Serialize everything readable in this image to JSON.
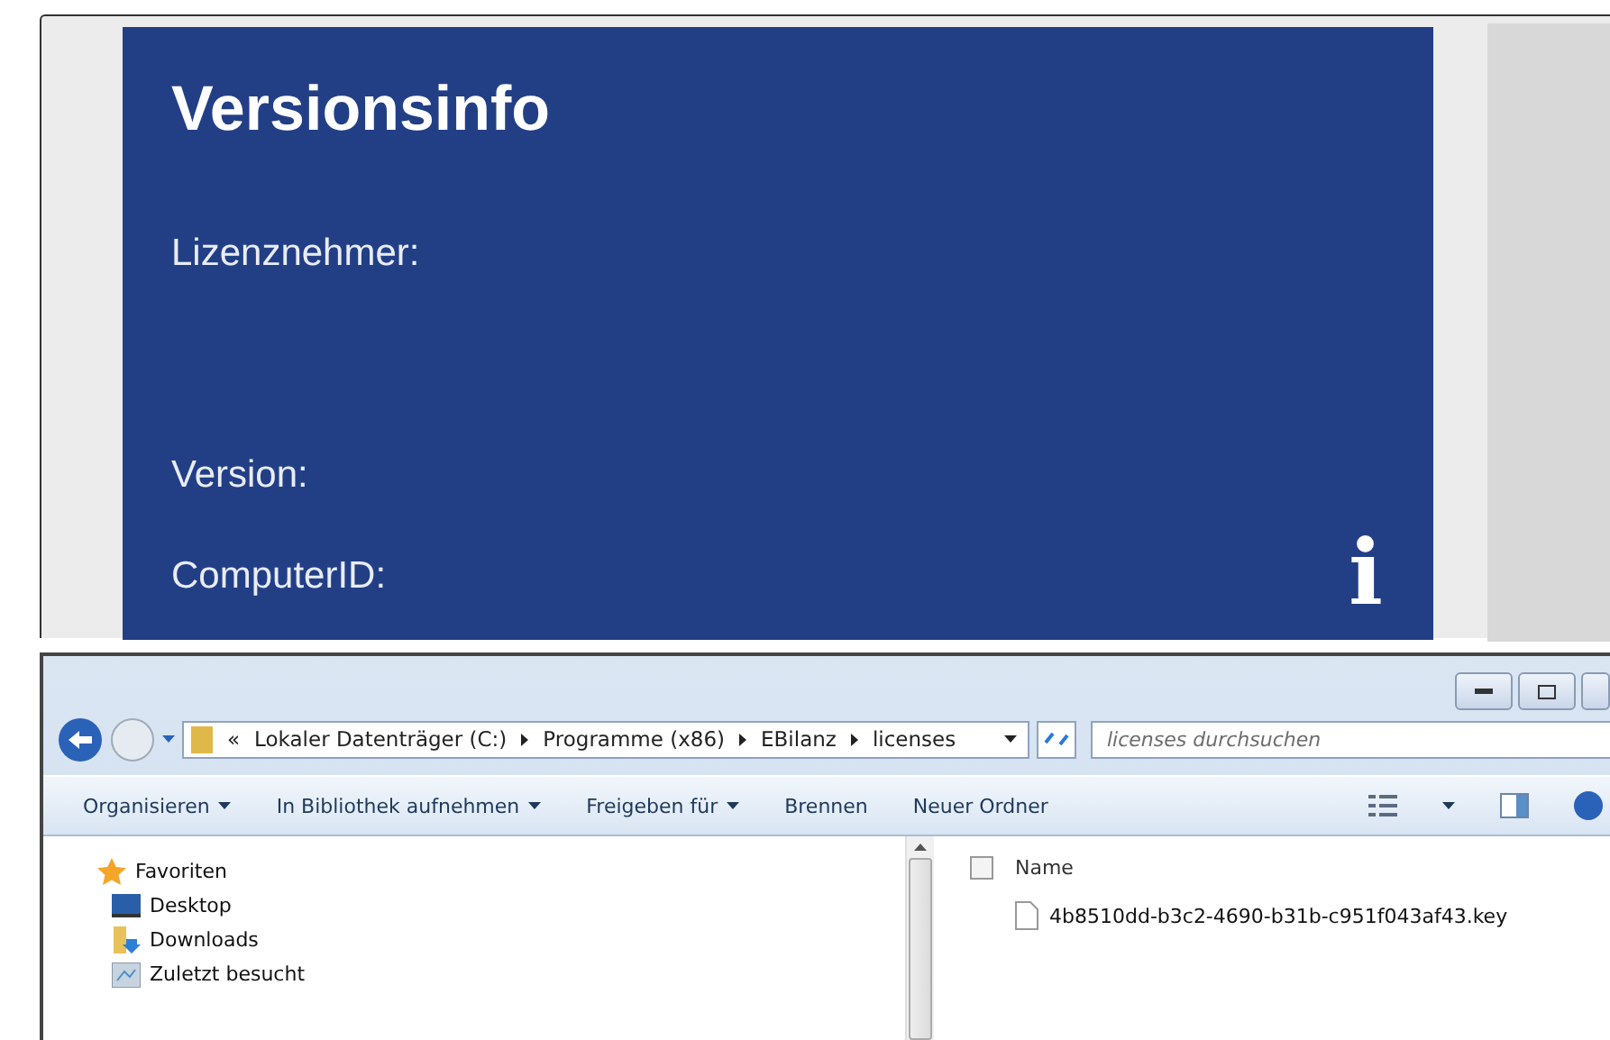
{
  "version_dialog": {
    "title": "Versionsinfo",
    "fields": [
      "Lizenznehmer:",
      "Version:",
      "ComputerID:"
    ],
    "info_glyph": "i"
  },
  "explorer": {
    "overflow_mark": "«",
    "breadcrumb": [
      "Lokaler Datenträger (C:)",
      "Programme (x86)",
      "EBilanz",
      "licenses"
    ],
    "search": {
      "placeholder": "licenses durchsuchen"
    },
    "toolbar": [
      {
        "label": "Organisieren",
        "dropdown": true
      },
      {
        "label": "In Bibliothek aufnehmen",
        "dropdown": true
      },
      {
        "label": "Freigeben für",
        "dropdown": true
      },
      {
        "label": "Brennen",
        "dropdown": false
      },
      {
        "label": "Neuer Ordner",
        "dropdown": false
      }
    ],
    "nav": [
      {
        "label": "Favoriten",
        "kind": "star",
        "children": [
          {
            "label": "Desktop",
            "kind": "desktop"
          },
          {
            "label": "Downloads",
            "kind": "downloads"
          },
          {
            "label": "Zuletzt besucht",
            "kind": "recent"
          }
        ]
      }
    ],
    "column": {
      "label": "Name",
      "checked": false
    },
    "files": [
      {
        "name": "4b8510dd-b3c2-4690-b31b-c951f043af43.key"
      }
    ]
  }
}
